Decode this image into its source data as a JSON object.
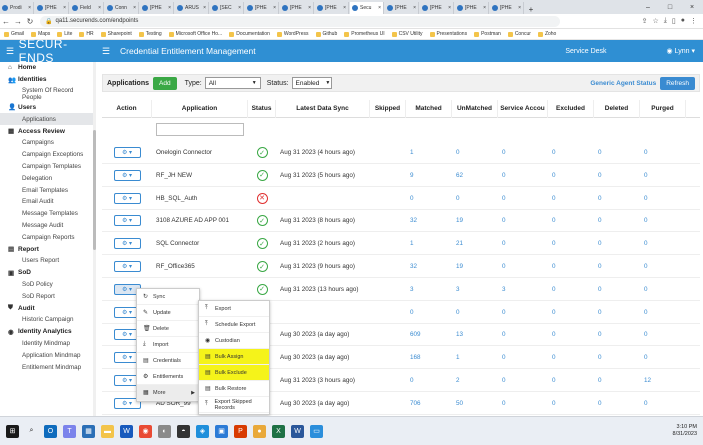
{
  "browser": {
    "tabs": [
      {
        "label": "Prodi"
      },
      {
        "label": "[PHE"
      },
      {
        "label": "Field"
      },
      {
        "label": "Conn"
      },
      {
        "label": "[PHE"
      },
      {
        "label": "ARUS"
      },
      {
        "label": "[SEC"
      },
      {
        "label": "[PHE"
      },
      {
        "label": "[PHE"
      },
      {
        "label": "[PHE"
      },
      {
        "label": "Secu",
        "active": true
      },
      {
        "label": "[PHE"
      },
      {
        "label": "[PHE"
      },
      {
        "label": "[PHE"
      },
      {
        "label": "[PHE"
      }
    ],
    "url": "qa11.securends.com/endpoints",
    "bookmarks": [
      "Gmail",
      "Maps",
      "Lite",
      "HR",
      "Sharepoint",
      "Testing",
      "Microsoft Office Ho...",
      "Documentation",
      "WordPress",
      "Github",
      "Prometheus UI",
      "CSV Utility",
      "Presentations",
      "Postman",
      "Concur",
      "Zoho"
    ]
  },
  "header": {
    "logo": "SECUR-ENDS",
    "title": "Credential Entitlement Management",
    "service_desk": "Service Desk",
    "user": "Lynn"
  },
  "sidebar": [
    {
      "label": "Home",
      "section": true,
      "icon": "⌂"
    },
    {
      "label": "Identities",
      "section": true,
      "icon": "👥"
    },
    {
      "label": "System Of Record People",
      "wrap": true
    },
    {
      "label": "Users",
      "section": true,
      "icon": "👤"
    },
    {
      "label": "Applications",
      "active": true
    },
    {
      "label": "Access Review",
      "section": true,
      "icon": "▦"
    },
    {
      "label": "Campaigns"
    },
    {
      "label": "Campaign Exceptions"
    },
    {
      "label": "Campaign Templates"
    },
    {
      "label": "Delegation"
    },
    {
      "label": "Email Templates"
    },
    {
      "label": "Email Audit"
    },
    {
      "label": "Message Templates"
    },
    {
      "label": "Message Audit"
    },
    {
      "label": "Campaign Reports"
    },
    {
      "label": "Report",
      "section": true,
      "icon": "▤"
    },
    {
      "label": "Users Report"
    },
    {
      "label": "SoD",
      "section": true,
      "icon": "▣"
    },
    {
      "label": "SoD Policy"
    },
    {
      "label": "SoD Report"
    },
    {
      "label": "Audit",
      "section": true,
      "icon": "⛊"
    },
    {
      "label": "Historic Campaign"
    },
    {
      "label": "Identity Analytics",
      "section": true,
      "icon": "◉"
    },
    {
      "label": "Identity Mindmap"
    },
    {
      "label": "Application Mindmap"
    },
    {
      "label": "Entitlement Mindmap"
    }
  ],
  "filters": {
    "label": "Applications",
    "add": "Add",
    "type_label": "Type:",
    "type_value": "All",
    "status_label": "Status:",
    "status_value": "Enabled",
    "agent_status": "Generic Agent Status",
    "refresh": "Refresh"
  },
  "columns": [
    "Action",
    "Application",
    "Status",
    "Latest Data Sync",
    "Skipped",
    "Matched",
    "UnMatched",
    "Service Accou",
    "Excluded",
    "Deleted",
    "Purged"
  ],
  "rows": [
    {
      "app": "Onelogin Connector",
      "status": "ok",
      "sync": "Aug 31 2023 (4 hours ago)",
      "matched": "1",
      "unmatched": "0",
      "service": "0",
      "excluded": "0",
      "deleted": "0",
      "purged": "0"
    },
    {
      "app": "RF_JH NEW",
      "status": "ok",
      "sync": "Aug 31 2023 (5 hours ago)",
      "matched": "9",
      "unmatched": "62",
      "service": "0",
      "excluded": "0",
      "deleted": "0",
      "purged": "0"
    },
    {
      "app": "HB_SQL_Auth",
      "status": "err",
      "sync": "",
      "matched": "0",
      "unmatched": "0",
      "service": "0",
      "excluded": "0",
      "deleted": "0",
      "purged": "0"
    },
    {
      "app": "3108 AZURE AD APP 001",
      "status": "ok",
      "sync": "Aug 31 2023 (8 hours ago)",
      "matched": "32",
      "unmatched": "19",
      "service": "0",
      "excluded": "0",
      "deleted": "0",
      "purged": "0"
    },
    {
      "app": "SQL Connector",
      "status": "ok",
      "sync": "Aug 31 2023 (2 hours ago)",
      "matched": "1",
      "unmatched": "21",
      "service": "0",
      "excluded": "0",
      "deleted": "0",
      "purged": "0"
    },
    {
      "app": "RF_Office365",
      "status": "ok",
      "sync": "Aug 31 2023 (9 hours ago)",
      "matched": "32",
      "unmatched": "19",
      "service": "0",
      "excluded": "0",
      "deleted": "0",
      "purged": "0"
    },
    {
      "app": "",
      "status": "ok",
      "sync": "Aug 31 2023 (13 hours ago)",
      "matched": "3",
      "unmatched": "3",
      "service": "3",
      "excluded": "0",
      "deleted": "0",
      "purged": "0"
    },
    {
      "app": "",
      "status": "",
      "sync": "",
      "matched": "0",
      "unmatched": "0",
      "service": "0",
      "excluded": "0",
      "deleted": "0",
      "purged": "0"
    },
    {
      "app": "",
      "status": "",
      "sync": "Aug 30 2023 (a day ago)",
      "matched": "609",
      "unmatched": "13",
      "service": "0",
      "excluded": "0",
      "deleted": "0",
      "purged": "0"
    },
    {
      "app": "",
      "status": "",
      "sync": "Aug 30 2023 (a day ago)",
      "matched": "168",
      "unmatched": "1",
      "service": "0",
      "excluded": "0",
      "deleted": "0",
      "purged": "0"
    },
    {
      "app": "",
      "status": "",
      "sync": "Aug 31 2023 (3 hours ago)",
      "matched": "0",
      "unmatched": "2",
      "service": "0",
      "excluded": "0",
      "deleted": "0",
      "purged": "12"
    },
    {
      "app": "AD SOR_99",
      "status": "",
      "sync": "Aug 30 2023 (a day ago)",
      "matched": "706",
      "unmatched": "50",
      "service": "0",
      "excluded": "0",
      "deleted": "0",
      "purged": "0"
    }
  ],
  "action_menu": [
    {
      "label": "Sync",
      "icon": "↻"
    },
    {
      "label": "Update",
      "icon": "✎"
    },
    {
      "label": "Delete",
      "icon": "🗑"
    },
    {
      "label": "Import",
      "icon": "⤓"
    },
    {
      "label": "Credentials",
      "icon": "▤"
    },
    {
      "label": "Entitlements",
      "icon": "⚙"
    },
    {
      "label": "More",
      "icon": "▦",
      "more": true
    }
  ],
  "more_menu": [
    {
      "label": "Export",
      "icon": "⤒"
    },
    {
      "label": "Schedule Export",
      "icon": "⤒"
    },
    {
      "label": "Custodian",
      "icon": "◉"
    },
    {
      "label": "Bulk Assign",
      "icon": "▤",
      "hl": true
    },
    {
      "label": "Bulk Exclude",
      "icon": "▤",
      "hl": true
    },
    {
      "label": "Bulk Restore",
      "icon": "▤"
    },
    {
      "label": "Export Skipped Records",
      "icon": "⤒"
    }
  ],
  "taskbar": {
    "time": "3:10 PM",
    "date": "8/31/2023",
    "apps": [
      {
        "color": "#1a1a1a",
        "glyph": "⊞"
      },
      {
        "color": "#eaeef4",
        "glyph": "⌕"
      },
      {
        "color": "#0f6cbd",
        "glyph": "O"
      },
      {
        "color": "#7b83eb",
        "glyph": "T"
      },
      {
        "color": "#2b6fb6",
        "glyph": "▦"
      },
      {
        "color": "#f3c44a",
        "glyph": "▬"
      },
      {
        "color": "#185abd",
        "glyph": "W"
      },
      {
        "color": "#e94b35",
        "glyph": "◉"
      },
      {
        "color": "#8a8a8a",
        "glyph": "◐"
      },
      {
        "color": "#333333",
        "glyph": "◓"
      },
      {
        "color": "#1f8fdb",
        "glyph": "◈"
      },
      {
        "color": "#2c7bd6",
        "glyph": "▣"
      },
      {
        "color": "#d83b01",
        "glyph": "P"
      },
      {
        "color": "#e9a93a",
        "glyph": "●"
      },
      {
        "color": "#1e7145",
        "glyph": "X"
      },
      {
        "color": "#2b579a",
        "glyph": "W"
      },
      {
        "color": "#2b8edb",
        "glyph": "▭"
      }
    ]
  }
}
